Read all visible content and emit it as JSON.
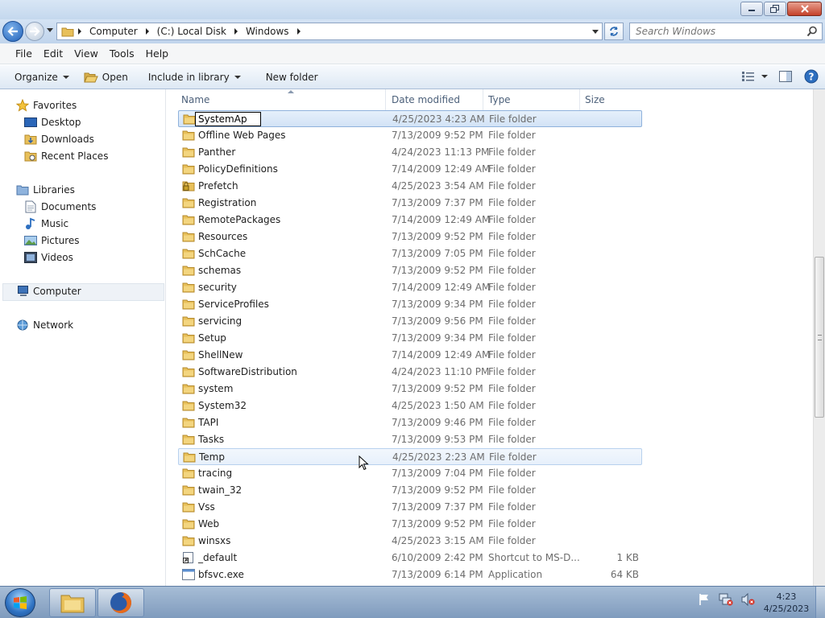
{
  "address": {
    "crumbs": [
      "Computer",
      "(C:) Local Disk",
      "Windows"
    ]
  },
  "search": {
    "placeholder": "Search Windows"
  },
  "menu": {
    "file": "File",
    "edit": "Edit",
    "view": "View",
    "tools": "Tools",
    "help": "Help"
  },
  "commands": {
    "organize": "Organize",
    "open": "Open",
    "include": "Include in library",
    "new_folder": "New folder"
  },
  "nav": {
    "favorites": "Favorites",
    "desktop": "Desktop",
    "downloads": "Downloads",
    "recent": "Recent Places",
    "libraries": "Libraries",
    "documents": "Documents",
    "music": "Music",
    "pictures": "Pictures",
    "videos": "Videos",
    "computer": "Computer",
    "network": "Network"
  },
  "columns": {
    "name": "Name",
    "date": "Date modified",
    "type": "Type",
    "size": "Size"
  },
  "rename_value": "SystemAp",
  "files": [
    {
      "name": "SystemAp",
      "date": "4/25/2023 4:23 AM",
      "type": "File folder",
      "size": "",
      "icon": "folder",
      "state": "selected"
    },
    {
      "name": "Offline Web Pages",
      "date": "7/13/2009 9:52 PM",
      "type": "File folder",
      "size": "",
      "icon": "folder"
    },
    {
      "name": "Panther",
      "date": "4/24/2023 11:13 PM",
      "type": "File folder",
      "size": "",
      "icon": "folder"
    },
    {
      "name": "PolicyDefinitions",
      "date": "7/14/2009 12:49 AM",
      "type": "File folder",
      "size": "",
      "icon": "folder"
    },
    {
      "name": "Prefetch",
      "date": "4/25/2023 3:54 AM",
      "type": "File folder",
      "size": "",
      "icon": "locked-folder"
    },
    {
      "name": "Registration",
      "date": "7/13/2009 7:37 PM",
      "type": "File folder",
      "size": "",
      "icon": "folder"
    },
    {
      "name": "RemotePackages",
      "date": "7/14/2009 12:49 AM",
      "type": "File folder",
      "size": "",
      "icon": "folder"
    },
    {
      "name": "Resources",
      "date": "7/13/2009 9:52 PM",
      "type": "File folder",
      "size": "",
      "icon": "folder"
    },
    {
      "name": "SchCache",
      "date": "7/13/2009 7:05 PM",
      "type": "File folder",
      "size": "",
      "icon": "folder"
    },
    {
      "name": "schemas",
      "date": "7/13/2009 9:52 PM",
      "type": "File folder",
      "size": "",
      "icon": "folder"
    },
    {
      "name": "security",
      "date": "7/14/2009 12:49 AM",
      "type": "File folder",
      "size": "",
      "icon": "folder"
    },
    {
      "name": "ServiceProfiles",
      "date": "7/13/2009 9:34 PM",
      "type": "File folder",
      "size": "",
      "icon": "folder"
    },
    {
      "name": "servicing",
      "date": "7/13/2009 9:56 PM",
      "type": "File folder",
      "size": "",
      "icon": "folder"
    },
    {
      "name": "Setup",
      "date": "7/13/2009 9:34 PM",
      "type": "File folder",
      "size": "",
      "icon": "folder"
    },
    {
      "name": "ShellNew",
      "date": "7/14/2009 12:49 AM",
      "type": "File folder",
      "size": "",
      "icon": "folder"
    },
    {
      "name": "SoftwareDistribution",
      "date": "4/24/2023 11:10 PM",
      "type": "File folder",
      "size": "",
      "icon": "folder"
    },
    {
      "name": "system",
      "date": "7/13/2009 9:52 PM",
      "type": "File folder",
      "size": "",
      "icon": "folder"
    },
    {
      "name": "System32",
      "date": "4/25/2023 1:50 AM",
      "type": "File folder",
      "size": "",
      "icon": "folder"
    },
    {
      "name": "TAPI",
      "date": "7/13/2009 9:46 PM",
      "type": "File folder",
      "size": "",
      "icon": "folder"
    },
    {
      "name": "Tasks",
      "date": "7/13/2009 9:53 PM",
      "type": "File folder",
      "size": "",
      "icon": "folder"
    },
    {
      "name": "Temp",
      "date": "4/25/2023 2:23 AM",
      "type": "File folder",
      "size": "",
      "icon": "folder",
      "state": "hover"
    },
    {
      "name": "tracing",
      "date": "7/13/2009 7:04 PM",
      "type": "File folder",
      "size": "",
      "icon": "folder"
    },
    {
      "name": "twain_32",
      "date": "7/13/2009 9:52 PM",
      "type": "File folder",
      "size": "",
      "icon": "folder"
    },
    {
      "name": "Vss",
      "date": "7/13/2009 7:37 PM",
      "type": "File folder",
      "size": "",
      "icon": "folder"
    },
    {
      "name": "Web",
      "date": "7/13/2009 9:52 PM",
      "type": "File folder",
      "size": "",
      "icon": "folder"
    },
    {
      "name": "winsxs",
      "date": "4/25/2023 3:15 AM",
      "type": "File folder",
      "size": "",
      "icon": "folder"
    },
    {
      "name": "_default",
      "date": "6/10/2009 2:42 PM",
      "type": "Shortcut to MS-D...",
      "size": "1 KB",
      "icon": "shortcut"
    },
    {
      "name": "bfsvc.exe",
      "date": "7/13/2009 6:14 PM",
      "type": "Application",
      "size": "64 KB",
      "icon": "application"
    }
  ],
  "clock": {
    "time": "4:23",
    "date": "4/25/2023"
  },
  "colors": {
    "selection": "#d3e3f6",
    "selection_border": "#8fb2dc",
    "folder": "#e8c05a",
    "taskbar": "#8fa9c9"
  }
}
